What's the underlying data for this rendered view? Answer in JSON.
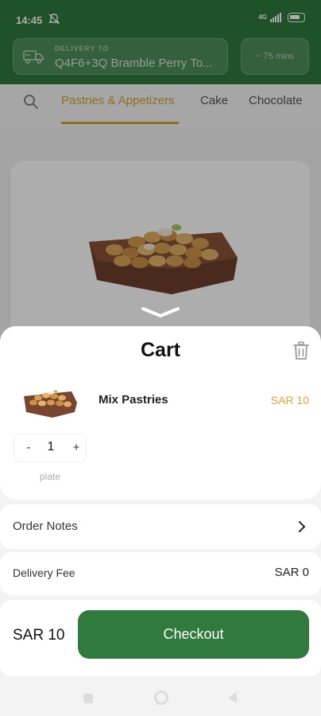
{
  "status_bar": {
    "time": "14:45",
    "network": "4G"
  },
  "header": {
    "delivery_label": "DELIVERY TO",
    "delivery_address": "Q4F6+3Q Bramble Perry To...",
    "eta": "~ 75 mins"
  },
  "tabs": [
    {
      "label": "Pastries & Appetizers",
      "active": true
    },
    {
      "label": "Cake",
      "active": false
    },
    {
      "label": "Chocolate",
      "active": false
    }
  ],
  "cart": {
    "title": "Cart",
    "item": {
      "name": "Mix Pastries",
      "price": "SAR 10",
      "quantity": "1",
      "unit": "plate",
      "minus": "-",
      "plus": "+"
    },
    "order_notes_label": "Order Notes",
    "delivery_fee_label": "Delivery Fee",
    "delivery_fee_value": "SAR 0",
    "total": "SAR 10",
    "checkout_label": "Checkout"
  },
  "colors": {
    "brand_green": "#2f7a3c",
    "accent_gold": "#d4a22e",
    "price_gold": "#e0a530"
  },
  "icons": [
    "notification-off-icon",
    "truck-icon",
    "search-icon",
    "chevron-down-icon",
    "trash-icon",
    "chevron-right-icon"
  ]
}
